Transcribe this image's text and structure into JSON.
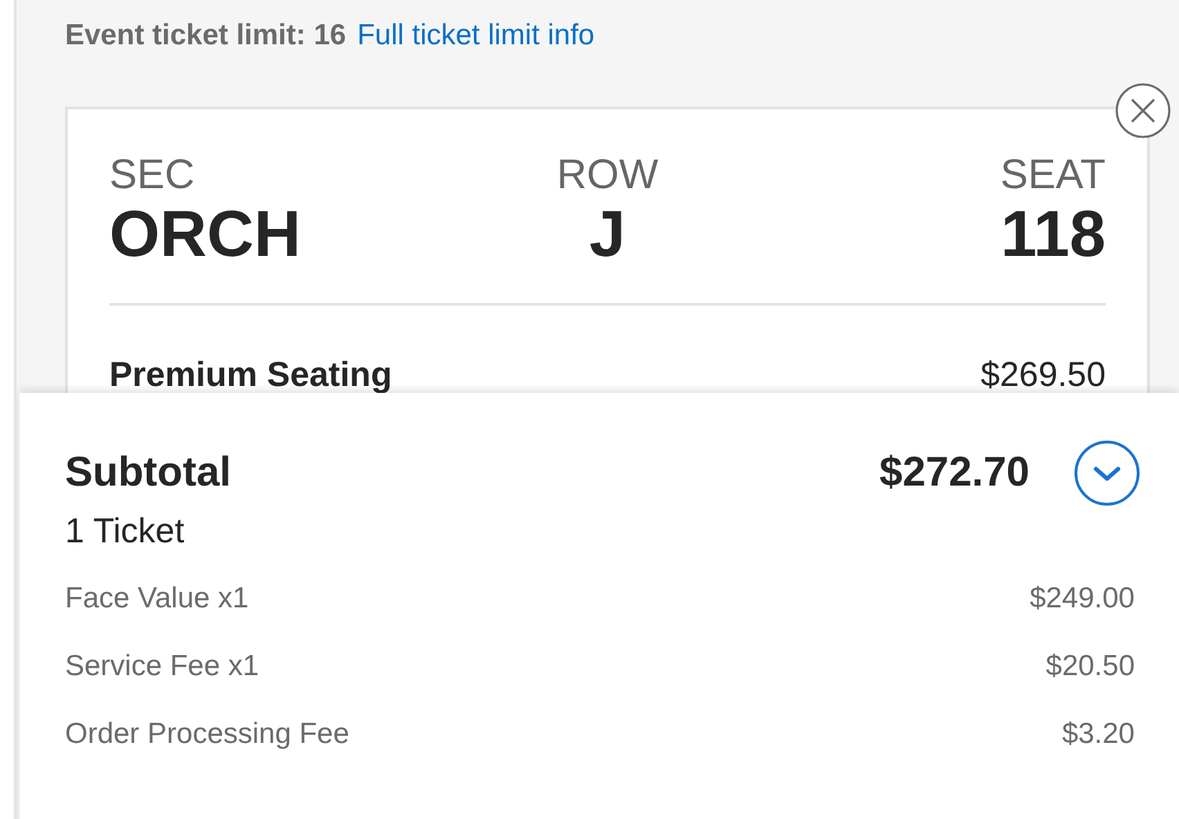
{
  "ticket_limit": {
    "label": "Event ticket limit: 16",
    "link": "Full ticket limit info"
  },
  "seat": {
    "fields": [
      {
        "label": "SEC",
        "value": "ORCH"
      },
      {
        "label": "ROW",
        "value": "J"
      },
      {
        "label": "SEAT",
        "value": "118"
      }
    ],
    "type": "Premium Seating",
    "price": "$269.50"
  },
  "summary": {
    "title": "Subtotal",
    "total": "$272.70",
    "count": "1 Ticket",
    "lines": [
      {
        "label": "Face Value x1",
        "amount": "$249.00"
      },
      {
        "label": "Service Fee x1",
        "amount": "$20.50"
      },
      {
        "label": "Order Processing Fee",
        "amount": "$3.20"
      }
    ]
  }
}
